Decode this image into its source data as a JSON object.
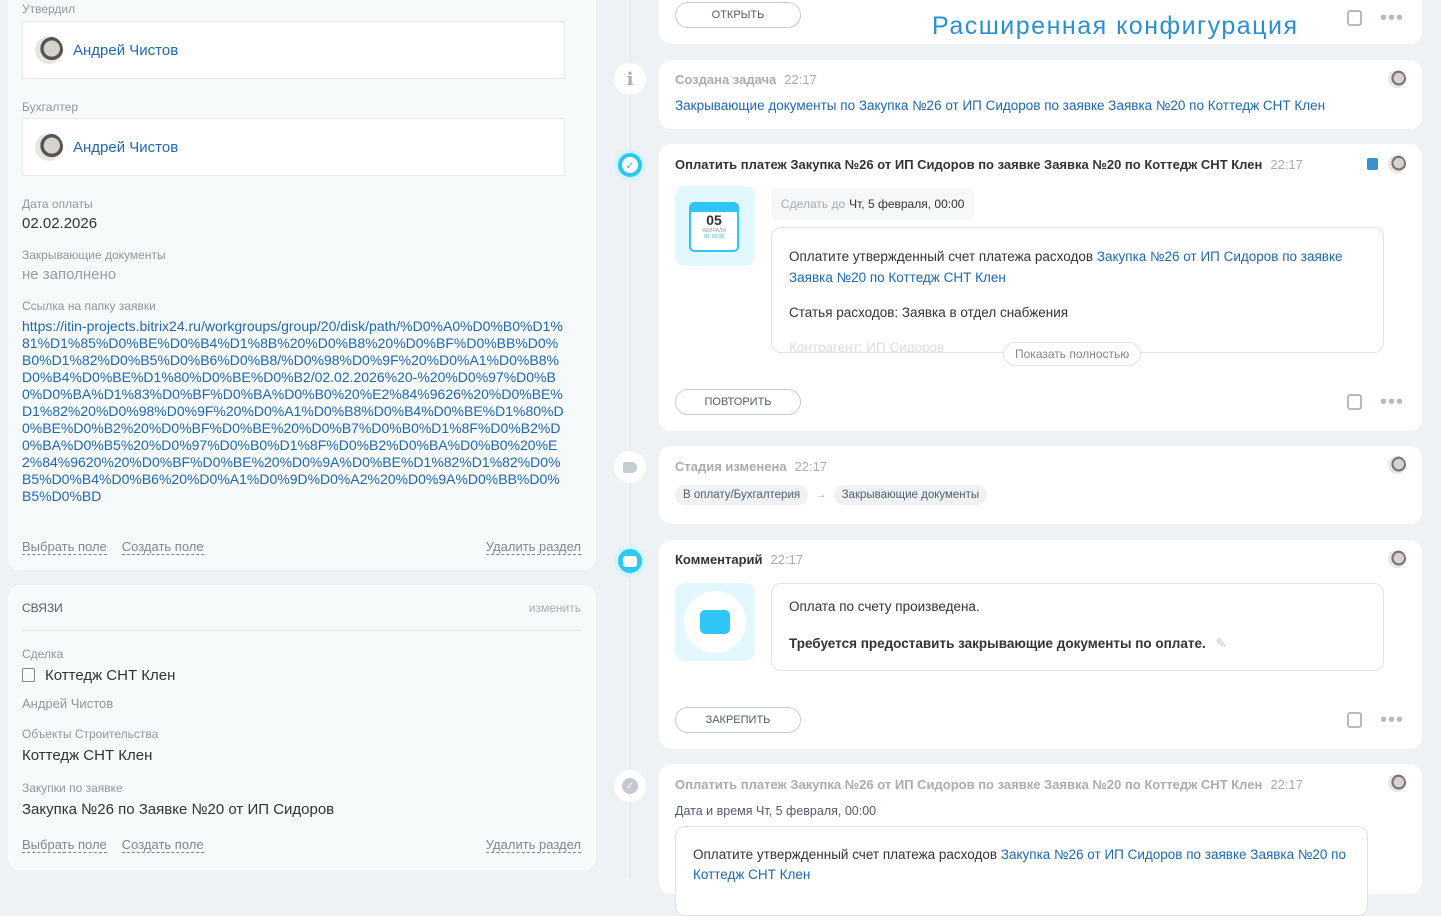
{
  "left": {
    "approved_label": "Утвердил",
    "approved_user": "Андрей Чистов",
    "accountant_label": "Бухгалтер",
    "accountant_user": "Андрей Чистов",
    "pay_date_label": "Дата оплаты",
    "pay_date": "02.02.2026",
    "closing_docs_label": "Закрывающие документы",
    "closing_docs": "не заполнено",
    "folder_link_label": "Ссылка на папку заявки",
    "folder_link": "https://itin-projects.bitrix24.ru/workgroups/group/20/disk/path/%D0%A0%D0%B0%D1%81%D1%85%D0%BE%D0%B4%D1%8B%20%D0%B8%20%D0%BF%D0%BB%D0%B0%D1%82%D0%B5%D0%B6%D0%B8/%D0%98%D0%9F%20%D0%A1%D0%B8%D0%B4%D0%BE%D1%80%D0%BE%D0%B2/02.02.2026%20-%20%D0%97%D0%B0%D0%BA%D1%83%D0%BF%D0%BA%D0%B0%20%E2%84%9626%20%D0%BE%D1%82%20%D0%98%D0%9F%20%D0%A1%D0%B8%D0%B4%D0%BE%D1%80%D0%BE%D0%B2%20%D0%BF%D0%BE%20%D0%B7%D0%B0%D1%8F%D0%B2%D0%BA%D0%B5%20%D0%97%D0%B0%D1%8F%D0%B2%D0%BA%D0%B0%20%E2%84%9620%20%D0%BF%D0%BE%20%D0%9A%D0%BE%D1%82%D1%82%D0%B5%D0%B4%D0%B6%20%D0%A1%D0%9D%D0%A2%20%D0%9A%D0%BB%D0%B5%D0%BD",
    "select_field": "Выбрать поле",
    "create_field": "Создать поле",
    "delete_section": "Удалить раздел"
  },
  "links_section": {
    "title": "СВЯЗИ",
    "edit": "изменить",
    "deal_label": "Сделка",
    "deal": "Коттедж СНТ Клен",
    "deal_owner": "Андрей Чистов",
    "objects_label": "Объекты Строительства",
    "objects": "Коттедж СНТ Клен",
    "purchases_label": "Закупки по заявке",
    "purchases": "Закупка №26 по Заявке №20 от ИП Сидоров",
    "select_field": "Выбрать поле",
    "create_field": "Создать поле",
    "delete_section": "Удалить раздел"
  },
  "top_card": {
    "open": "ОТКРЫТЬ",
    "watermark": "Расширенная конфигурация"
  },
  "created": {
    "title": "Создана задача",
    "time": "22:17",
    "link": "Закрывающие документы по Закупка №26 от ИП Сидоров по заявке Заявка №20 по Коттедж СНТ Клен"
  },
  "task": {
    "title": "Оплатить платеж Закупка №26 от ИП Сидоров по заявке Заявка №20 по Коттедж СНТ Клен",
    "time": "22:17",
    "cal_day": "05",
    "cal_month": "ФЕВРАЛЯ",
    "cal_time": "ЧТ 00:00",
    "deadline_label": "Сделать до",
    "deadline": "Чт, 5 февраля, 00:00",
    "text": "Оплатите утвержденный счет платежа расходов",
    "text_link": "Закупка №26 от ИП Сидоров по заявке Заявка №20 по Коттедж СНТ Клен",
    "article": "Статья расходов: Заявка в отдел снабжения",
    "faded": "Контрагент: ИП Сидоров",
    "show_full": "Показать полностью",
    "repeat": "ПОВТОРИТЬ"
  },
  "stage": {
    "title": "Стадия изменена",
    "time": "22:17",
    "from": "В оплату/Бухгалтерия",
    "arrow": "→",
    "to": "Закрывающие документы"
  },
  "comment": {
    "title": "Комментарий",
    "time": "22:17",
    "line1": "Оплата по счету произведена.",
    "line2": "Требуется предоставить закрывающие документы по оплате.",
    "pin": "ЗАКРЕПИТЬ"
  },
  "done_task": {
    "title": "Оплатить платеж Закупка №26 от ИП Сидоров по заявке Заявка №20 по Коттедж СНТ Клен",
    "time": "22:17",
    "datetime_label": "Дата и время",
    "datetime": "Чт, 5 февраля, 00:00",
    "text": "Оплатите утвержденный счет платежа расходов",
    "text_link": "Закупка №26 от ИП Сидоров по заявке Заявка №20 по Коттедж СНТ Клен"
  },
  "colors": {
    "accent": "#2fc6f6",
    "link": "#2067b0"
  }
}
